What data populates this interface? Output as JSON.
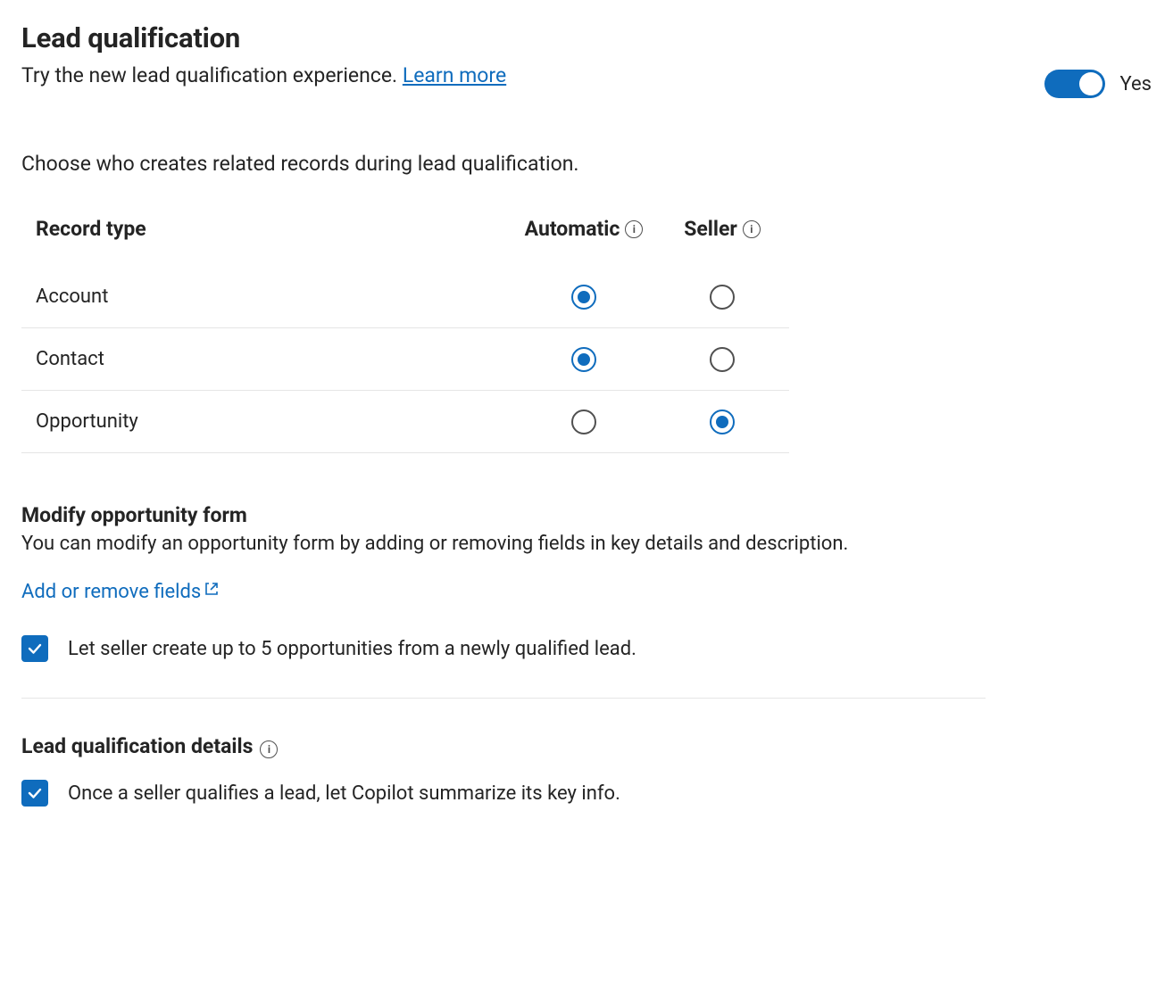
{
  "header": {
    "title": "Lead qualification",
    "subtitle_prefix": "Try the new lead qualification experience. ",
    "learn_more_label": "Learn more",
    "toggle_label": "Yes",
    "toggle_on": true
  },
  "choose_text": "Choose who creates related records during lead qualification.",
  "table": {
    "col_label": "Record type",
    "col_auto": "Automatic",
    "col_seller": "Seller",
    "rows": [
      {
        "label": "Account",
        "auto_checked": true,
        "seller_checked": false
      },
      {
        "label": "Contact",
        "auto_checked": true,
        "seller_checked": false
      },
      {
        "label": "Opportunity",
        "auto_checked": false,
        "seller_checked": true
      }
    ]
  },
  "modify_section": {
    "title": "Modify opportunity form",
    "desc": "You can modify an opportunity form by adding or removing fields in key details and description.",
    "link_label": "Add or remove fields",
    "checkbox_label": "Let seller create up to 5 opportunities from a newly qualified lead.",
    "checkbox_checked": true
  },
  "details_section": {
    "title": "Lead qualification details",
    "checkbox_label": "Once a seller qualifies a lead, let Copilot summarize its key info.",
    "checkbox_checked": true
  }
}
